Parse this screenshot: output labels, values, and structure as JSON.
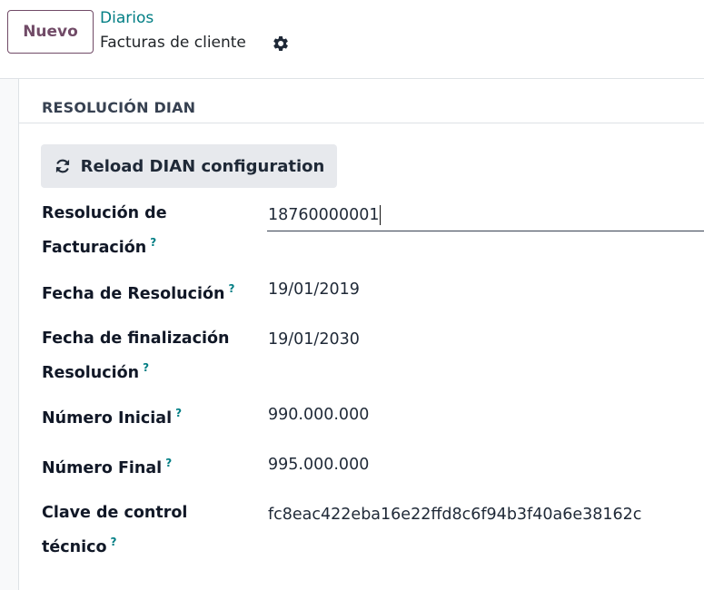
{
  "control_panel": {
    "new_button_label": "Nuevo",
    "breadcrumb_parent": "Diarios",
    "breadcrumb_current": "Facturas de cliente",
    "settings_icon": "gear-icon"
  },
  "section": {
    "title": "RESOLUCIÓN DIAN",
    "reload_button_label": "Reload DIAN configuration",
    "reload_icon": "refresh-icon"
  },
  "fields": {
    "resolution_label_line1": "Resolución de",
    "resolution_label_line2": "Facturación",
    "resolution_value": "18760000001",
    "resolution_date_label": "Fecha de Resolución",
    "resolution_date_value": "19/01/2019",
    "end_date_label_line1": "Fecha de finalización",
    "end_date_label_line2": "Resolución",
    "end_date_value": "19/01/2030",
    "initial_number_label": "Número Inicial",
    "initial_number_value": "990.000.000",
    "final_number_label": "Número Final",
    "final_number_value": "995.000.000",
    "tech_key_label_line1": "Clave de control",
    "tech_key_label_line2": "técnico",
    "tech_key_value": "fc8eac422eba16e22ffd8c6f94b3f40a6e38162c",
    "help_marker": "?"
  },
  "colors": {
    "brand": "#714B67",
    "link": "#017e84"
  }
}
